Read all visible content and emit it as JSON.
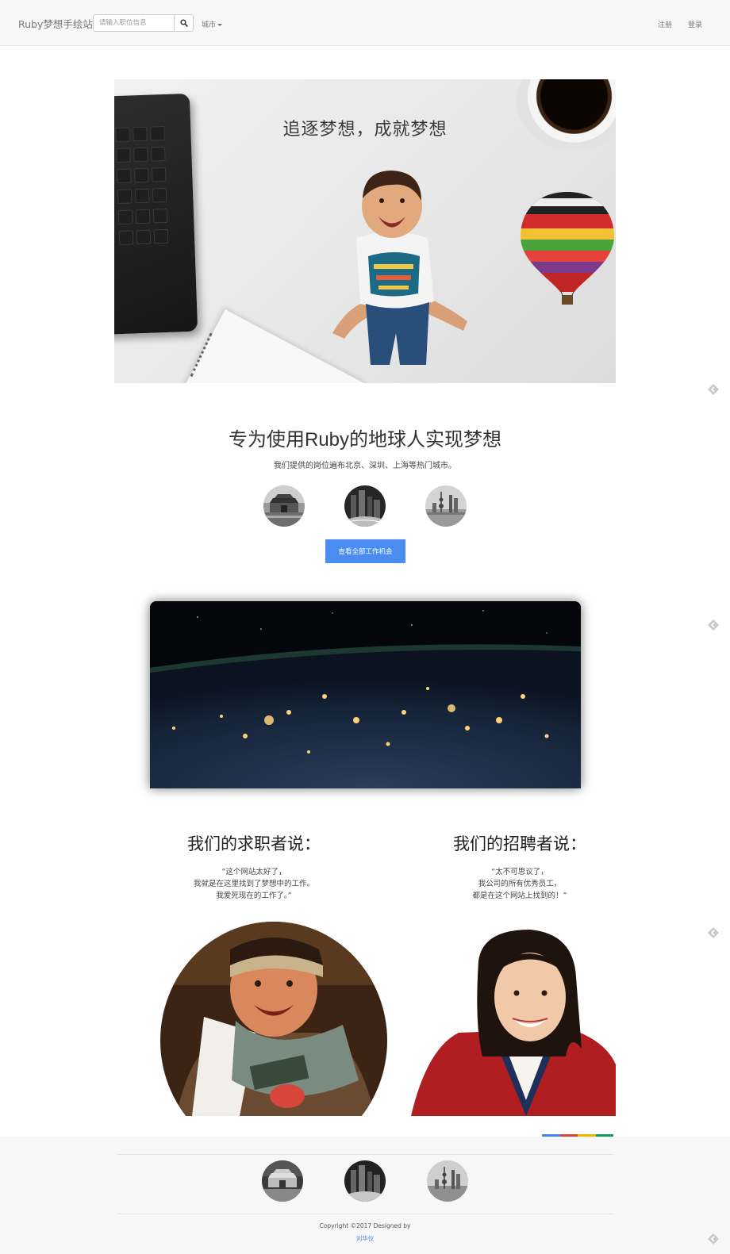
{
  "navbar": {
    "brand": "Ruby梦想手绘站",
    "search_placeholder": "请输入职位信息",
    "search_icon": "search-icon",
    "city_label": "城市",
    "register_label": "注册",
    "login_label": "登录"
  },
  "hero": {
    "title": "追逐梦想，成就梦想"
  },
  "intro": {
    "title_prefix": "专为使用",
    "title_ruby": "Ruby",
    "title_suffix": "的地球人实现梦想",
    "subtitle": "我们提供的岗位遍布北京、深圳、上海等热门城市。",
    "cities": [
      "北京",
      "深圳",
      "上海"
    ],
    "cta_label": "查看全部工作机会"
  },
  "testimonials": {
    "seekers": {
      "title": "我们的求职者说：",
      "lines": [
        "“这个网站太好了，",
        "我就是在这里找到了梦想中的工作。",
        "我爱死现在的工作了。”"
      ]
    },
    "recruiters": {
      "title": "我们的招聘者说：",
      "lines": [
        "“太不可思议了，",
        "我公司的所有优秀员工，",
        "都是在这个网站上找到的！”"
      ]
    }
  },
  "footer": {
    "copyright": "Copyright ©2017 Designed by",
    "author": "刘华仪"
  },
  "colors": {
    "primary": "#4a8cef",
    "navbar_bg": "#f8f8f8",
    "footer_bg": "#f7f7f7",
    "google_bar": [
      "#4285f4",
      "#db4437",
      "#f4b400",
      "#0f9d58"
    ]
  }
}
